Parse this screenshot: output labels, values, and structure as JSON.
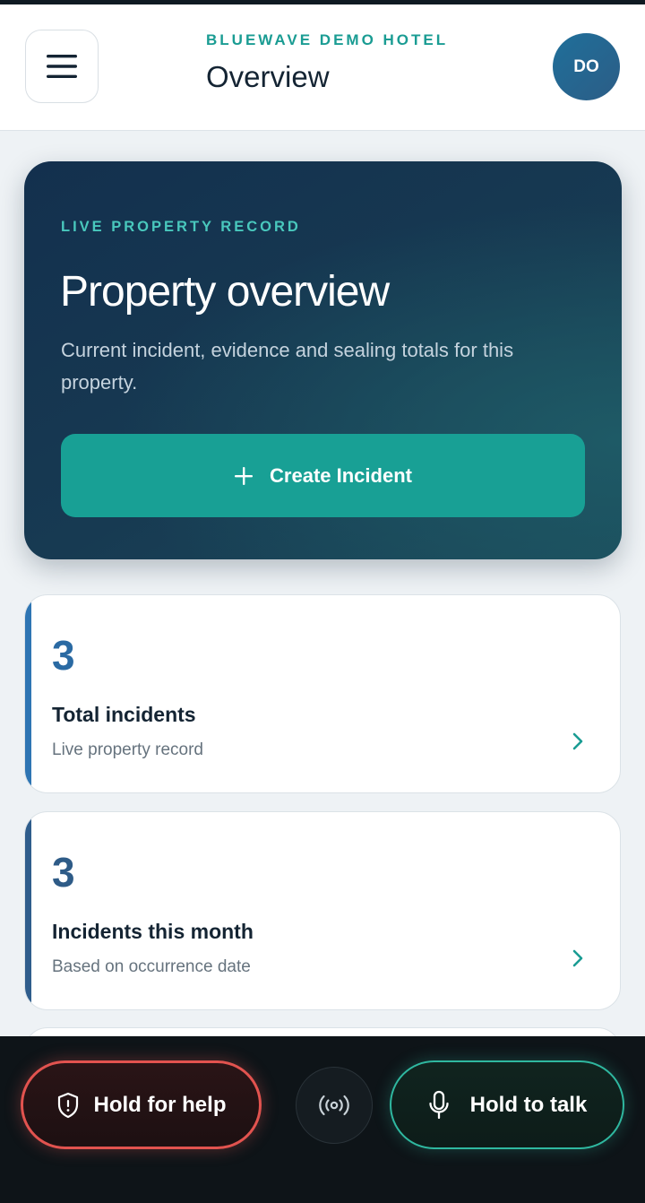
{
  "header": {
    "hotel_name": "BLUEWAVE DEMO HOTEL",
    "page_title": "Overview",
    "avatar_initials": "DO",
    "menu_icon": "hamburger-menu-icon"
  },
  "hero": {
    "kicker": "LIVE PROPERTY RECORD",
    "title": "Property overview",
    "description": "Current incident, evidence and sealing totals for this property.",
    "create_button_label": "Create Incident",
    "create_button_icon": "plus-icon"
  },
  "stats": [
    {
      "value": "3",
      "label": "Total incidents",
      "sub": "Live property record",
      "accent": "#2e75b3"
    },
    {
      "value": "3",
      "label": "Incidents this month",
      "sub": "Based on occurrence date",
      "accent": "#2f5d8c"
    }
  ],
  "bottom_bar": {
    "help_label": "Hold for help",
    "help_icon": "shield-alert-icon",
    "radio_icon": "broadcast-icon",
    "talk_label": "Hold to talk",
    "talk_icon": "microphone-icon"
  },
  "colors": {
    "brand_teal": "#18a095",
    "hero_bg": "#13304e",
    "help_red": "#e2534f",
    "talk_green": "#2fb8a0"
  }
}
